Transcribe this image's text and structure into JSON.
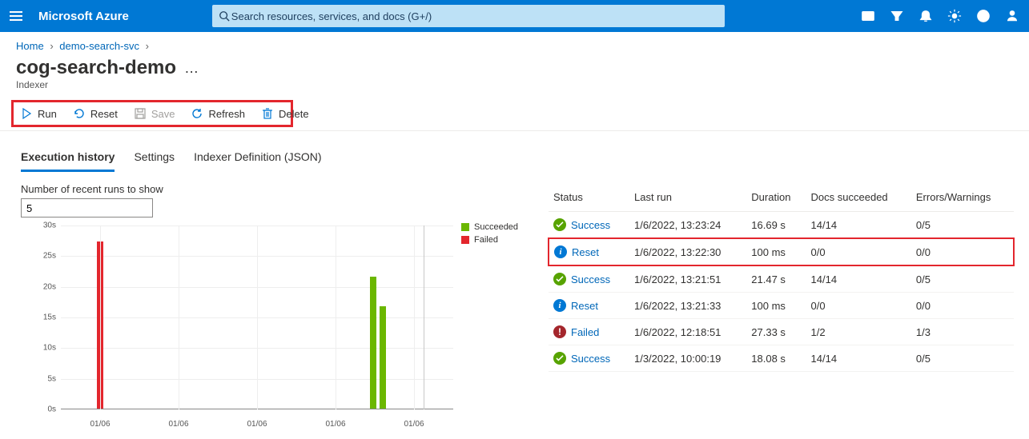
{
  "topbar": {
    "brand": "Microsoft Azure",
    "search_placeholder": "Search resources, services, and docs (G+/)"
  },
  "breadcrumb": {
    "home": "Home",
    "svc": "demo-search-svc"
  },
  "page": {
    "title": "cog-search-demo",
    "subtitle": "Indexer"
  },
  "toolbar": {
    "run": "Run",
    "reset": "Reset",
    "save": "Save",
    "refresh": "Refresh",
    "delete": "Delete"
  },
  "tabs": {
    "exec": "Execution history",
    "settings": "Settings",
    "json": "Indexer Definition (JSON)"
  },
  "leftpanel": {
    "num_label": "Number of recent runs to show",
    "num_value": "5"
  },
  "legend": {
    "s": "Succeeded",
    "f": "Failed"
  },
  "colors": {
    "success": "#6bb700",
    "fail": "#e3262d"
  },
  "chart_data": {
    "type": "bar",
    "categories": [
      "01/06",
      "01/06",
      "01/06",
      "01/06",
      "01/06"
    ],
    "series": [
      {
        "name": "Succeeded",
        "values": [
          0,
          0,
          0,
          21.5,
          16.7
        ]
      },
      {
        "name": "Failed",
        "values": [
          27.3,
          0,
          0,
          0,
          0
        ]
      }
    ],
    "ylabel": "",
    "ylim": [
      0,
      30
    ],
    "yticks": [
      "0s",
      "5s",
      "10s",
      "15s",
      "20s",
      "25s",
      "30s"
    ],
    "xticks": [
      "01/06",
      "01/06",
      "01/06",
      "01/06",
      "01/06"
    ]
  },
  "table": {
    "headers": {
      "status": "Status",
      "last": "Last run",
      "dur": "Duration",
      "docs": "Docs succeeded",
      "ew": "Errors/Warnings"
    },
    "rows": [
      {
        "kind": "success",
        "status": "Success",
        "last": "1/6/2022, 13:23:24",
        "dur": "16.69 s",
        "docs": "14/14",
        "ew": "0/5",
        "hl": false
      },
      {
        "kind": "reset",
        "status": "Reset",
        "last": "1/6/2022, 13:22:30",
        "dur": "100 ms",
        "docs": "0/0",
        "ew": "0/0",
        "hl": true
      },
      {
        "kind": "success",
        "status": "Success",
        "last": "1/6/2022, 13:21:51",
        "dur": "21.47 s",
        "docs": "14/14",
        "ew": "0/5",
        "hl": false
      },
      {
        "kind": "reset",
        "status": "Reset",
        "last": "1/6/2022, 13:21:33",
        "dur": "100 ms",
        "docs": "0/0",
        "ew": "0/0",
        "hl": false
      },
      {
        "kind": "failed",
        "status": "Failed",
        "last": "1/6/2022, 12:18:51",
        "dur": "27.33 s",
        "docs": "1/2",
        "ew": "1/3",
        "hl": false
      },
      {
        "kind": "success",
        "status": "Success",
        "last": "1/3/2022, 10:00:19",
        "dur": "18.08 s",
        "docs": "14/14",
        "ew": "0/5",
        "hl": false
      }
    ]
  }
}
